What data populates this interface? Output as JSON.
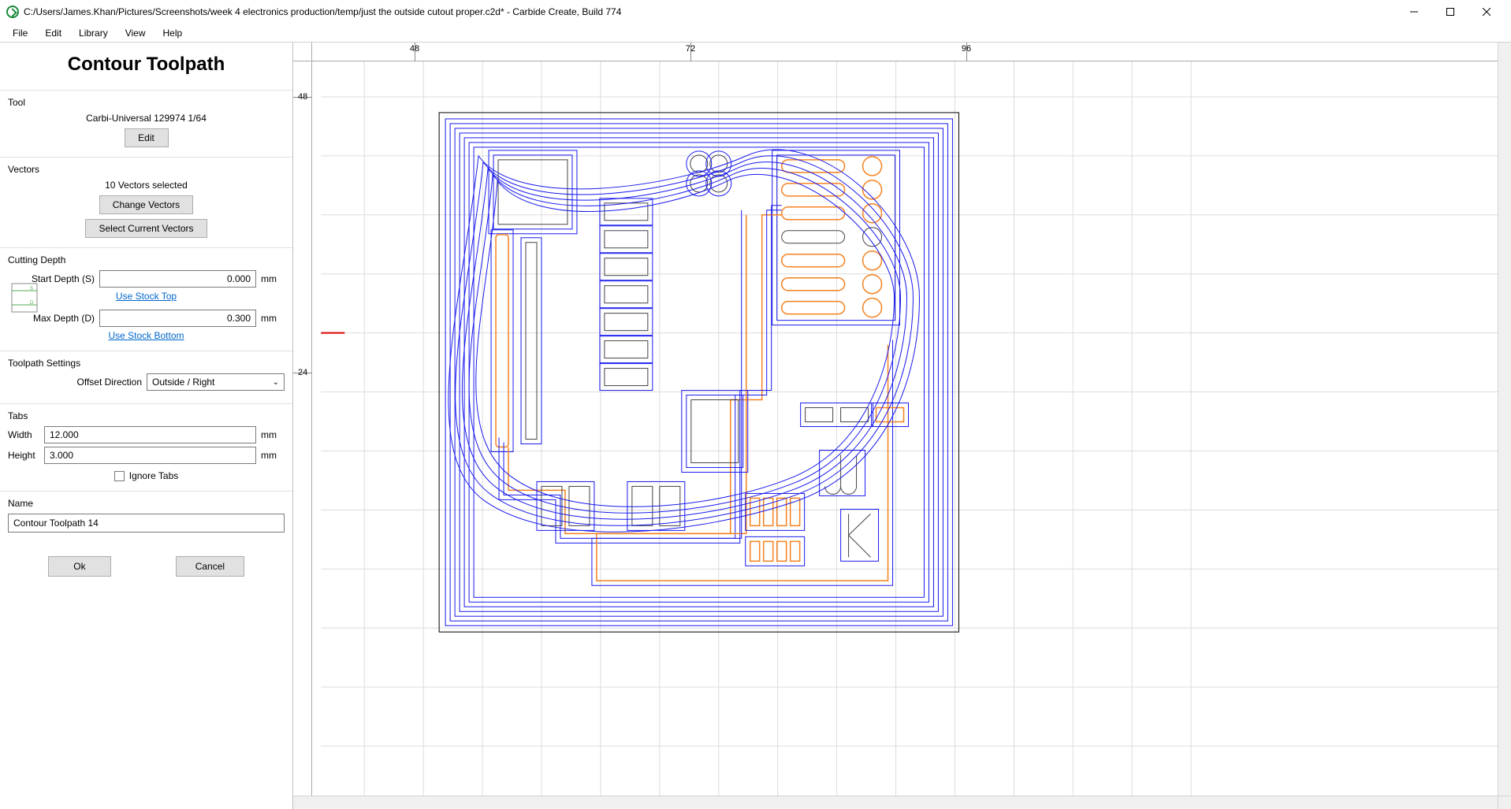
{
  "window": {
    "title": "C:/Users/James.Khan/Pictures/Screenshots/week 4 electronics production/temp/just the outside cutout proper.c2d* - Carbide Create, Build 774"
  },
  "menu": {
    "file": "File",
    "edit": "Edit",
    "library": "Library",
    "view": "View",
    "help": "Help"
  },
  "panel": {
    "title": "Contour Toolpath",
    "tool": {
      "section": "Tool",
      "name": "Carbi-Universal 129974 1/64",
      "edit": "Edit"
    },
    "vectors": {
      "section": "Vectors",
      "status": "10 Vectors selected",
      "change": "Change Vectors",
      "select_current": "Select Current Vectors"
    },
    "depth": {
      "section": "Cutting Depth",
      "start_label": "Start Depth (S)",
      "start_value": "0.000",
      "use_stock_top": "Use Stock Top",
      "max_label": "Max Depth (D)",
      "max_value": "0.300",
      "use_stock_bottom": "Use Stock Bottom",
      "unit": "mm"
    },
    "settings": {
      "section": "Toolpath Settings",
      "offset_label": "Offset Direction",
      "offset_value": "Outside / Right"
    },
    "tabs": {
      "section": "Tabs",
      "width_label": "Width",
      "width_value": "12.000",
      "height_label": "Height",
      "height_value": "3.000",
      "unit": "mm",
      "ignore_label": "Ignore Tabs"
    },
    "name": {
      "section": "Name",
      "value": "Contour Toolpath 14"
    },
    "buttons": {
      "ok": "Ok",
      "cancel": "Cancel"
    }
  },
  "ruler": {
    "h_ticks": [
      "48",
      "72",
      "96"
    ],
    "v_ticks": [
      "48",
      "24"
    ]
  }
}
